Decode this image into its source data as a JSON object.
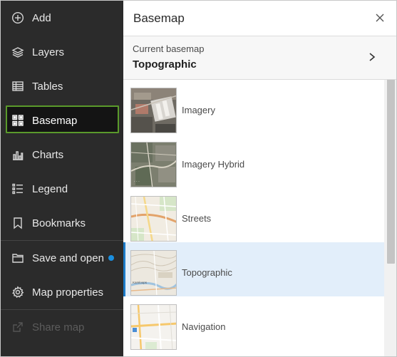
{
  "sidebar": {
    "items": [
      {
        "label": "Add",
        "icon": "plus-circle-icon"
      },
      {
        "label": "Layers",
        "icon": "layers-icon"
      },
      {
        "label": "Tables",
        "icon": "table-icon"
      },
      {
        "label": "Basemap",
        "icon": "basemap-icon",
        "active": true
      },
      {
        "label": "Charts",
        "icon": "chart-icon"
      },
      {
        "label": "Legend",
        "icon": "legend-icon"
      },
      {
        "label": "Bookmarks",
        "icon": "bookmark-icon"
      },
      {
        "label": "Save and open",
        "icon": "folder-icon",
        "has_indicator": true
      },
      {
        "label": "Map properties",
        "icon": "gear-icon"
      },
      {
        "label": "Share map",
        "icon": "share-icon",
        "disabled": true
      }
    ],
    "active_color": "#5a9a2b",
    "indicator_color": "#1a8fe0"
  },
  "panel": {
    "title": "Basemap",
    "current": {
      "caption": "Current basemap",
      "name": "Topographic"
    },
    "basemaps": [
      {
        "label": "Imagery"
      },
      {
        "label": "Imagery Hybrid"
      },
      {
        "label": "Streets"
      },
      {
        "label": "Topographic",
        "selected": true
      },
      {
        "label": "Navigation"
      }
    ],
    "selected_color": "#e2eefa",
    "accent_color": "#1c7bc8"
  }
}
